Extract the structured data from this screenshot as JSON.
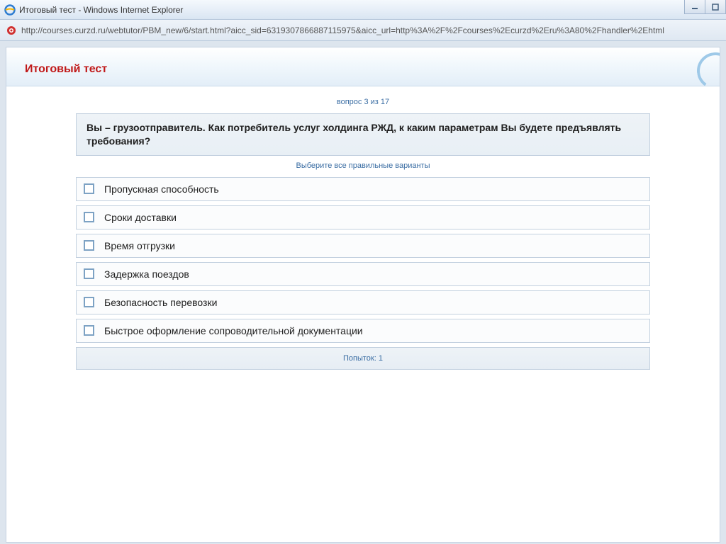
{
  "window": {
    "title": "Итоговый тест - Windows Internet Explorer"
  },
  "address": {
    "url": "http://courses.curzd.ru/webtutor/PBM_new/6/start.html?aicc_sid=6319307866887115975&aicc_url=http%3A%2F%2Fcourses%2Ecurzd%2Eru%3A80%2Fhandler%2Ehtml"
  },
  "page": {
    "title": "Итоговый тест"
  },
  "test": {
    "progress": "вопрос 3 из 17",
    "question": "Вы – грузоотправитель. Как потребитель услуг холдинга РЖД, к каким параметрам Вы будете предъявлять требования?",
    "hint": "Выберите все правильные варианты",
    "options": [
      {
        "label": "Пропускная способность"
      },
      {
        "label": "Сроки доставки"
      },
      {
        "label": "Время отгрузки"
      },
      {
        "label": "Задержка поездов"
      },
      {
        "label": "Безопасность перевозки"
      },
      {
        "label": "Быстрое оформление сопроводительной документации"
      }
    ],
    "attempts_label": "Попыток:",
    "attempts_value": "1"
  }
}
